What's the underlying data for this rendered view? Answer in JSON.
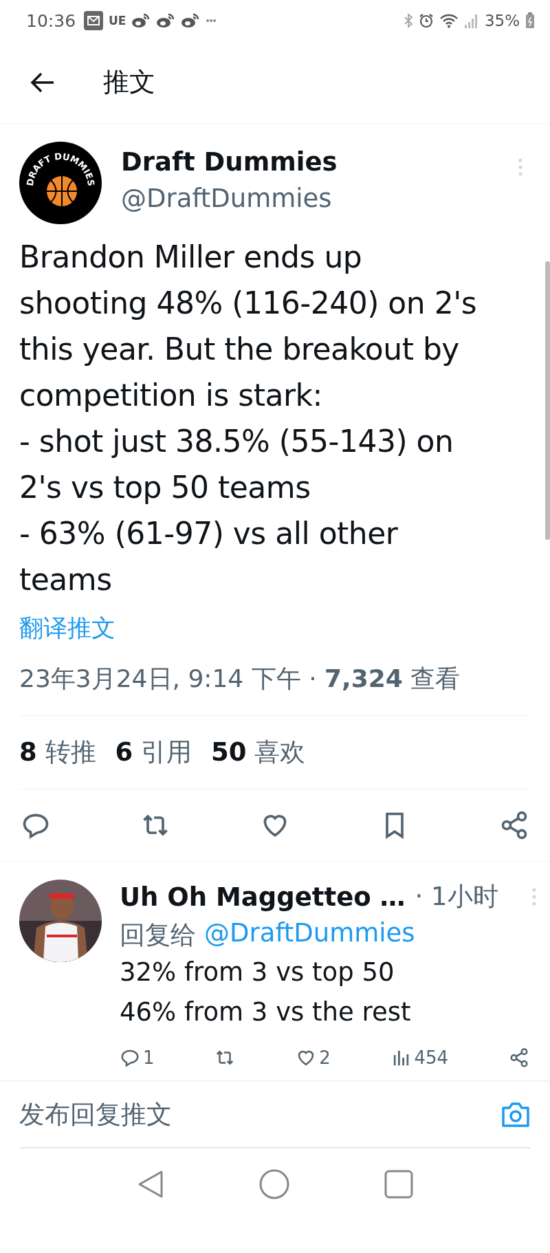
{
  "status_bar": {
    "time": "10:36",
    "ue_label": "UE",
    "battery": "35%"
  },
  "header": {
    "title": "推文"
  },
  "tweet": {
    "name": "Draft Dummies",
    "handle": "@DraftDummies",
    "logo_text": "DRAFT DUMMIES",
    "lines": [
      "Brandon Miller ends up",
      "shooting 48% (116-240) on 2's",
      "this year. But the breakout by",
      "competition is stark:",
      "- shot just 38.5% (55-143) on",
      "2's vs top 50 teams",
      "- 63% (61-97) vs all other",
      "teams"
    ],
    "translate": "翻译推文",
    "date": "23年3月24日, 9:14 下午 · **7,324** 查看",
    "stats": [
      {
        "count": "8",
        "label": "转推"
      },
      {
        "count": "6",
        "label": "引用"
      },
      {
        "count": "50",
        "label": "喜欢"
      }
    ]
  },
  "reply": {
    "name": "Uh Oh Maggetteo …",
    "time": "· 1小时",
    "reply_to_label": "回复给",
    "reply_to_handle": "@DraftDummies",
    "lines": [
      "32% from 3 vs top 50",
      "46% from 3 vs the rest"
    ],
    "actions": [
      {
        "kind": "reply",
        "count": "1"
      },
      {
        "kind": "retweet"
      },
      {
        "kind": "like",
        "count": "2"
      },
      {
        "kind": "views",
        "count": "454"
      },
      {
        "kind": "share"
      }
    ]
  },
  "compose": {
    "placeholder": "发布回复推文"
  }
}
